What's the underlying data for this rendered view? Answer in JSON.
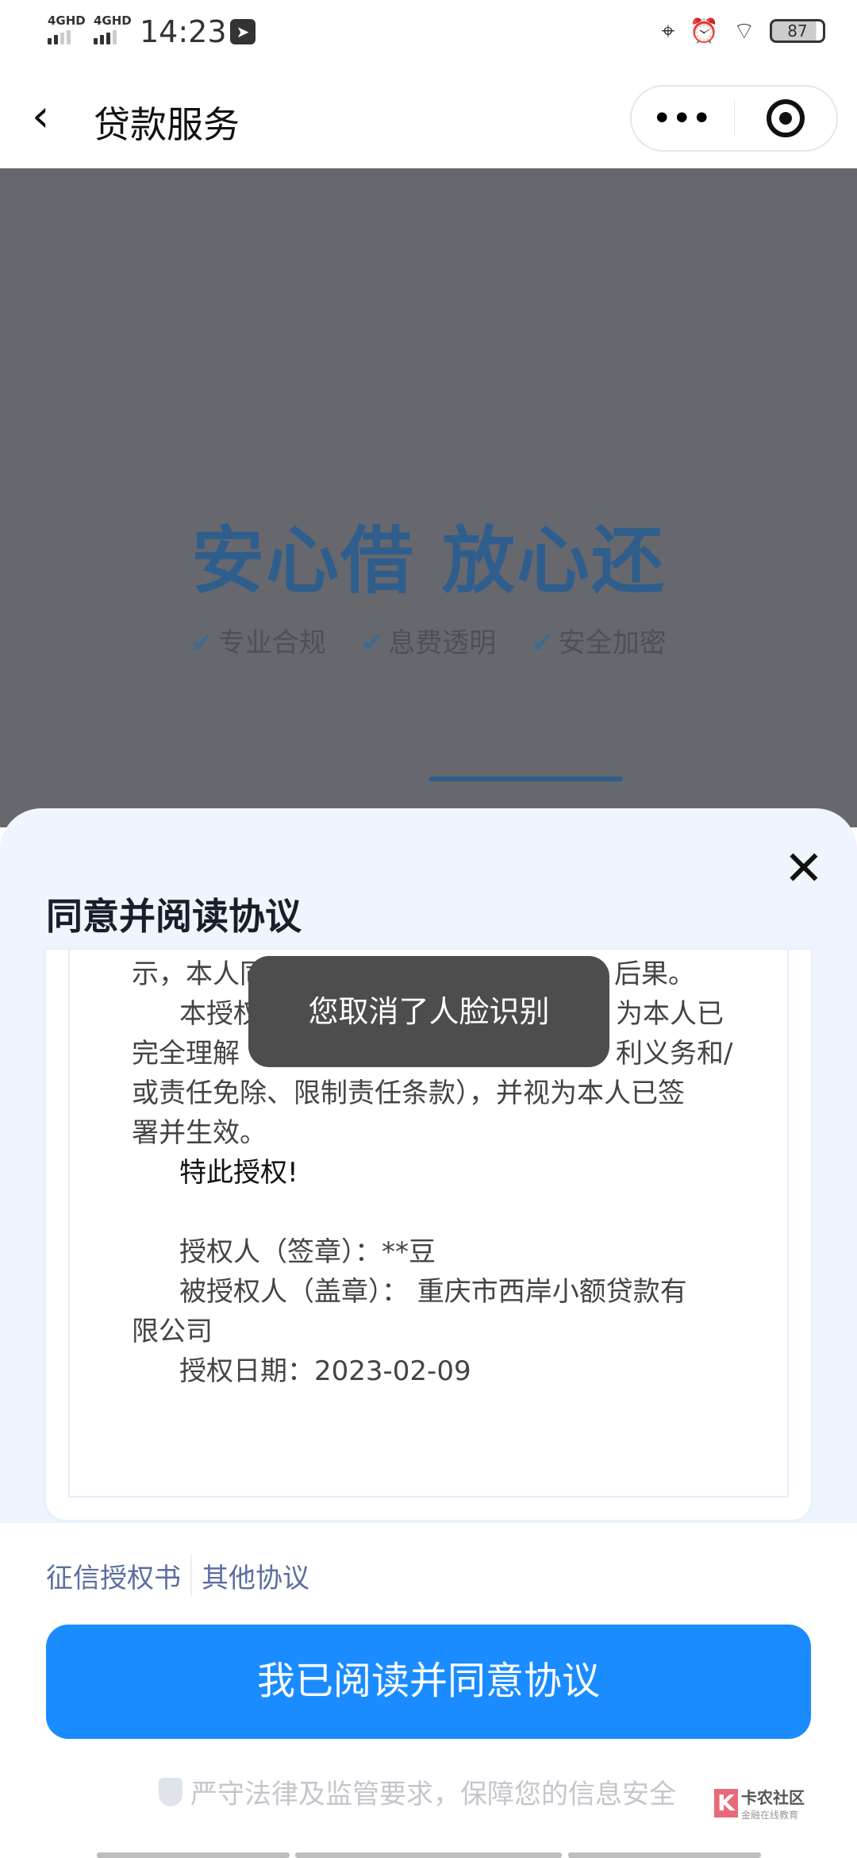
{
  "status_bar": {
    "network1": "4GHD",
    "network2": "4GHD",
    "time": "14:23",
    "battery": "87",
    "icons": [
      "telegram-icon",
      "location-icon",
      "alarm-icon",
      "wifi-icon",
      "battery-icon"
    ]
  },
  "nav": {
    "title": "贷款服务",
    "more": "•••"
  },
  "hero": {
    "slogan": "安心借 放心还",
    "features": [
      "专业合规",
      "息费透明",
      "安全加密"
    ],
    "progress_percent": 100
  },
  "sheet": {
    "title": "同意并阅读协议",
    "doc": {
      "l1a": "示，本人同",
      "l1b": "后果。",
      "l2a": "本授权",
      "l2b": "为本人已",
      "l3a": "完全理解",
      "l3b": "利义务和/",
      "l4": "或责任免除、限制责任条款），并视为本人已签",
      "l5": "署并生效。",
      "l6": "特此授权!",
      "l7": "授权人（签章）：**豆",
      "l8": "被授权人（盖章）： 重庆市西岸小额贷款有",
      "l9": "限公司",
      "l10": "授权日期：2023-02-09"
    }
  },
  "toast": "您取消了人脸识别",
  "links": [
    "征信授权书",
    "其他协议"
  ],
  "agree_button": "我已阅读并同意协议",
  "footer": "严守法律及监管要求，保障您的信息安全",
  "watermark": {
    "name": "卡农社区",
    "sub": "金融在线教育"
  },
  "colors": {
    "primary": "#1a8cff",
    "link": "#5a6ea0",
    "sheet_bg": "#eef5fd",
    "toast_bg": "#4d4d4d"
  }
}
